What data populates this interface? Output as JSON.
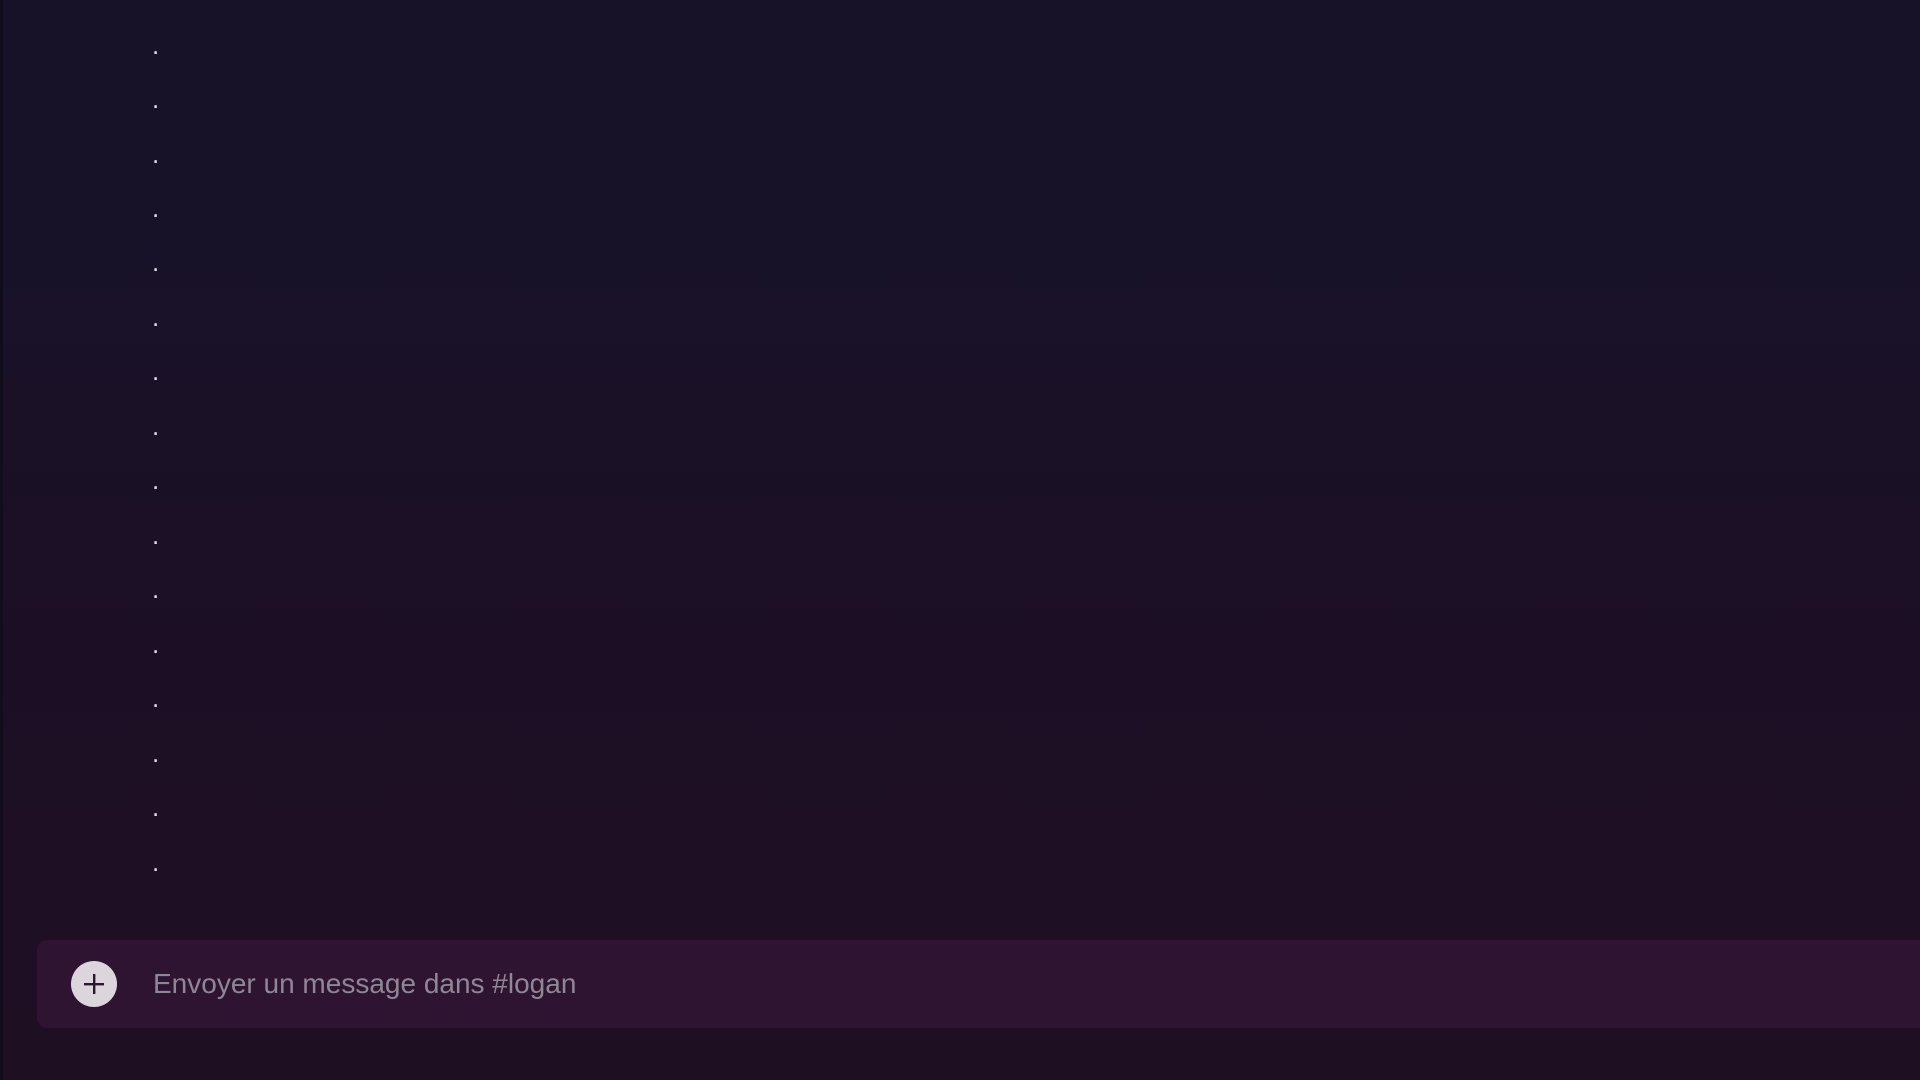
{
  "messages": [
    {
      "text": "."
    },
    {
      "text": "."
    },
    {
      "text": "."
    },
    {
      "text": "."
    },
    {
      "text": "."
    },
    {
      "text": "."
    },
    {
      "text": "."
    },
    {
      "text": "."
    },
    {
      "text": "."
    },
    {
      "text": "."
    },
    {
      "text": "."
    },
    {
      "text": "."
    },
    {
      "text": "."
    },
    {
      "text": "."
    },
    {
      "text": "."
    },
    {
      "text": "."
    },
    {
      "text": "."
    }
  ],
  "composer": {
    "placeholder": "Envoyer un message dans #logan",
    "value": "",
    "attach_icon": "plus-circle-icon"
  }
}
